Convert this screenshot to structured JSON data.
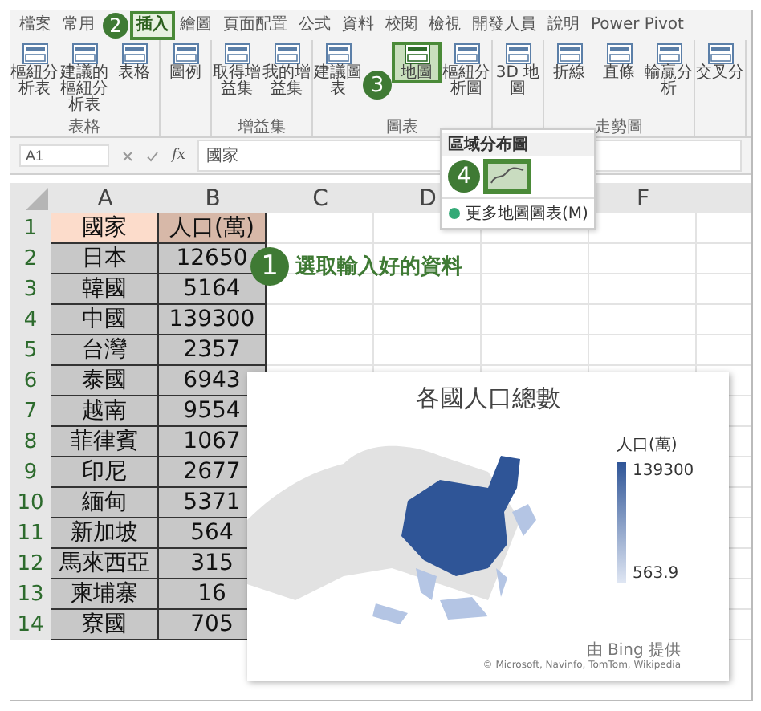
{
  "ribbon_tabs": [
    {
      "label": "檔案",
      "selected": false
    },
    {
      "label": "常用",
      "selected": false
    },
    {
      "label": "插入",
      "selected": true
    },
    {
      "label": "繪圖",
      "selected": false
    },
    {
      "label": "頁面配置",
      "selected": false
    },
    {
      "label": "公式",
      "selected": false
    },
    {
      "label": "資料",
      "selected": false
    },
    {
      "label": "校閱",
      "selected": false
    },
    {
      "label": "檢視",
      "selected": false
    },
    {
      "label": "開發人員",
      "selected": false
    },
    {
      "label": "說明",
      "selected": false
    },
    {
      "label": "Power Pivot",
      "selected": false
    }
  ],
  "ribbon_groups": [
    {
      "label": "表格",
      "buttons": [
        {
          "label": "樞紐分析表",
          "selected": false
        },
        {
          "label": "建議的樞紐分析表",
          "selected": false
        },
        {
          "label": "表格",
          "selected": false
        }
      ]
    },
    {
      "buttons": [
        {
          "label": "圖例",
          "selected": false
        }
      ]
    },
    {
      "label": "增益集",
      "buttons": [
        {
          "label": "取得增益集",
          "selected": false
        },
        {
          "label": "我的增益集",
          "selected": false
        }
      ]
    },
    {
      "label": "圖表",
      "buttons": [
        {
          "label": "建議圖表",
          "selected": false
        },
        {
          "label": "地圖",
          "selected": true
        },
        {
          "label": "樞紐分析圖",
          "selected": false
        }
      ]
    },
    {
      "buttons": [
        {
          "label": "3D 地圖",
          "selected": false
        }
      ]
    },
    {
      "label": "走勢圖",
      "buttons": [
        {
          "label": "折線",
          "selected": false
        },
        {
          "label": "直條",
          "selected": false
        },
        {
          "label": "輸贏分析",
          "selected": false
        }
      ]
    },
    {
      "buttons": [
        {
          "label": "交叉分",
          "selected": false
        }
      ]
    }
  ],
  "map_menu": {
    "items": [
      {
        "kind": "header",
        "label": "區域分布圖"
      },
      {
        "kind": "thumbnail",
        "selected": true
      },
      {
        "kind": "link",
        "label": "更多地圖圖表(M)"
      }
    ]
  },
  "formula_bar": {
    "name_box": "A1",
    "function_label": "fx",
    "value": "國家"
  },
  "sheet": {
    "columns": [
      {
        "label": "A",
        "hidden_before": false
      },
      {
        "label": "B",
        "hidden_before": false
      },
      {
        "label": "C",
        "hidden_before": false
      },
      {
        "label": "D",
        "hidden_before": false
      },
      {
        "label": "F",
        "hidden_before": true
      }
    ],
    "rows": [
      {
        "number": "1",
        "cells": [
          "國家",
          "人口(萬)"
        ]
      },
      {
        "number": "2",
        "cells": [
          "日本",
          "12650"
        ]
      },
      {
        "number": "3",
        "cells": [
          "韓國",
          "5164"
        ]
      },
      {
        "number": "4",
        "cells": [
          "中國",
          "139300"
        ]
      },
      {
        "number": "5",
        "cells": [
          "台灣",
          "2357"
        ]
      },
      {
        "number": "6",
        "cells": [
          "泰國",
          "6943"
        ]
      },
      {
        "number": "7",
        "cells": [
          "越南",
          "9554"
        ]
      },
      {
        "number": "8",
        "cells": [
          "菲律賓",
          "1067"
        ]
      },
      {
        "number": "9",
        "cells": [
          "印尼",
          "2677"
        ]
      },
      {
        "number": "10",
        "cells": [
          "緬甸",
          "5371"
        ]
      },
      {
        "number": "11",
        "cells": [
          "新加坡",
          "564"
        ]
      },
      {
        "number": "12",
        "cells": [
          "馬來西亞",
          "315"
        ]
      },
      {
        "number": "13",
        "cells": [
          "柬埔寨",
          "16"
        ]
      },
      {
        "number": "14",
        "cells": [
          "寮國",
          "705"
        ]
      }
    ]
  },
  "callouts": [
    {
      "number": "1",
      "text": "選取輸入好的資料"
    },
    {
      "number": "2"
    },
    {
      "number": "3"
    },
    {
      "number": "4"
    }
  ],
  "map_chart": {
    "title": "各國人口總數",
    "legend_title": "人口(萬)",
    "legend_max": "139300",
    "legend_min": "563.9",
    "credit": "由 Bing 提供",
    "copyright": "© Microsoft, Navinfo, TomTom, Wikipedia"
  }
}
